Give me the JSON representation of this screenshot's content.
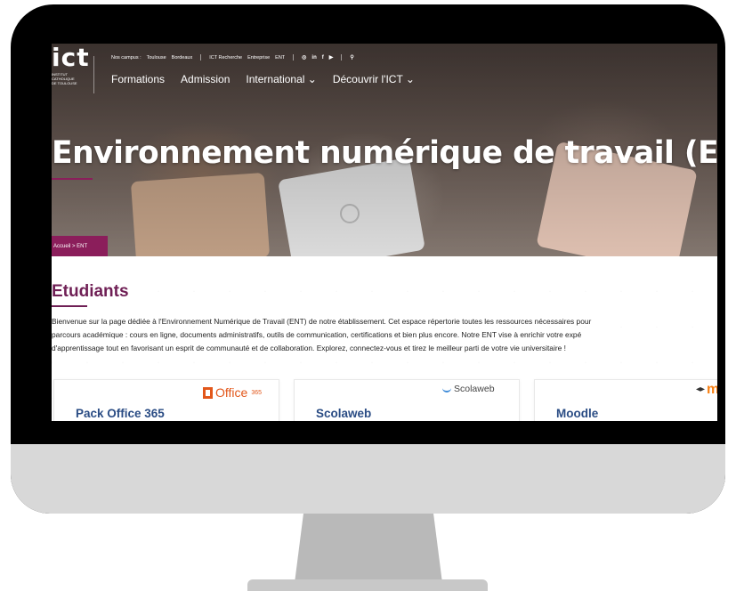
{
  "header": {
    "logo": "ict",
    "logo_sub": "INSTITUT\nCATHOLIQUE\nDE TOULOUSE",
    "nos_campus_label": "Nos campus :",
    "campus_toulouse": "Toulouse",
    "campus_bordeaux": "Bordeaux",
    "ict_recherche": "ICT Recherche",
    "entreprise": "Entreprise",
    "ent": "ENT",
    "social": {
      "instagram": "◎",
      "linkedin": "in",
      "facebook": "f",
      "youtube": "▶"
    },
    "search_glyph": "⚲"
  },
  "nav": {
    "formations": "Formations",
    "admission": "Admission",
    "international": "International ⌄",
    "decouvrir": "Découvrir l'ICT ⌄"
  },
  "hero": {
    "title": "Environnement numérique de travail (ENT)",
    "breadcrumb": "Accueil > ENT"
  },
  "content": {
    "title": "Etudiants",
    "intro_lines": [
      "Bienvenue sur la page dédiée à l'Environnement Numérique de Travail (ENT) de notre établissement. Cet espace répertorie toutes les ressources nécessaires pour",
      "parcours académique : cours en ligne, documents administratifs, outils de communication, certifications et bien plus encore. Notre ENT vise à enrichir votre expé",
      "d'apprentissage tout en favorisant un esprit de communauté et de collaboration. Explorez, connectez-vous et tirez le meilleur parti de votre vie universitaire !"
    ]
  },
  "cards": {
    "office": {
      "title": "Pack Office 365",
      "logo_text": "Office",
      "logo_sub": "365"
    },
    "scolaweb": {
      "title": "Scolaweb",
      "logo_text": "Scolaweb"
    },
    "moodle": {
      "title": "Moodle",
      "logo_text": "moo"
    }
  },
  "colors": {
    "accent": "#8b1e5b",
    "title_purple": "#6f1f55",
    "card_title_blue": "#2a4c84"
  }
}
